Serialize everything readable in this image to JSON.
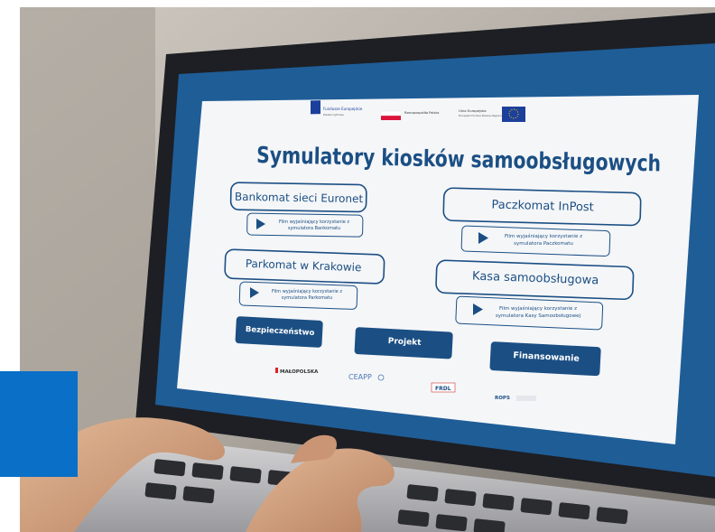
{
  "logos": {
    "fundusze": "Fundusze Europejskie",
    "fundusze_sub": "Polska Cyfrowa",
    "rzeczpospolita": "Rzeczpospolita Polska",
    "ue": "Unia Europejska",
    "ue_sub": "Europejski Fundusz Rozwoju Regionalnego"
  },
  "title": "Symulatory kiosków samoobsługowych",
  "simulators": [
    {
      "label": "Bankomat sieci Euronet",
      "video_line1": "Film wyjaśniający korzystanie z",
      "video_line2": "symulatora Bankomatu"
    },
    {
      "label": "Parkomat w Krakowie",
      "video_line1": "Film wyjaśniający korzystanie z",
      "video_line2": "symulatora Parkomatu"
    },
    {
      "label": "Paczkomat InPost",
      "video_line1": "Film wyjaśniający korzystanie z",
      "video_line2": "symulatora Paczkomatu"
    },
    {
      "label": "Kasa samoobsługowa",
      "video_line1": "Film wyjaśniający korzystanie z",
      "video_line2": "symulatora Kasy Samoobsługowej"
    }
  ],
  "nav": {
    "security": "Bezpieczeństwo",
    "project": "Projekt",
    "funding": "Finansowanie"
  },
  "partners": {
    "malopolska": "MAŁOPOLSKA",
    "ceapp": "CEAPP",
    "frdl": "FRDL",
    "rops": "ROPS"
  },
  "colors": {
    "screen_blue": "#1f5d97",
    "nav_blue": "#1b4f84",
    "accent_blue": "#0a6fc6",
    "eu_blue": "#1b3f9b",
    "poland_red": "#dc143c"
  }
}
